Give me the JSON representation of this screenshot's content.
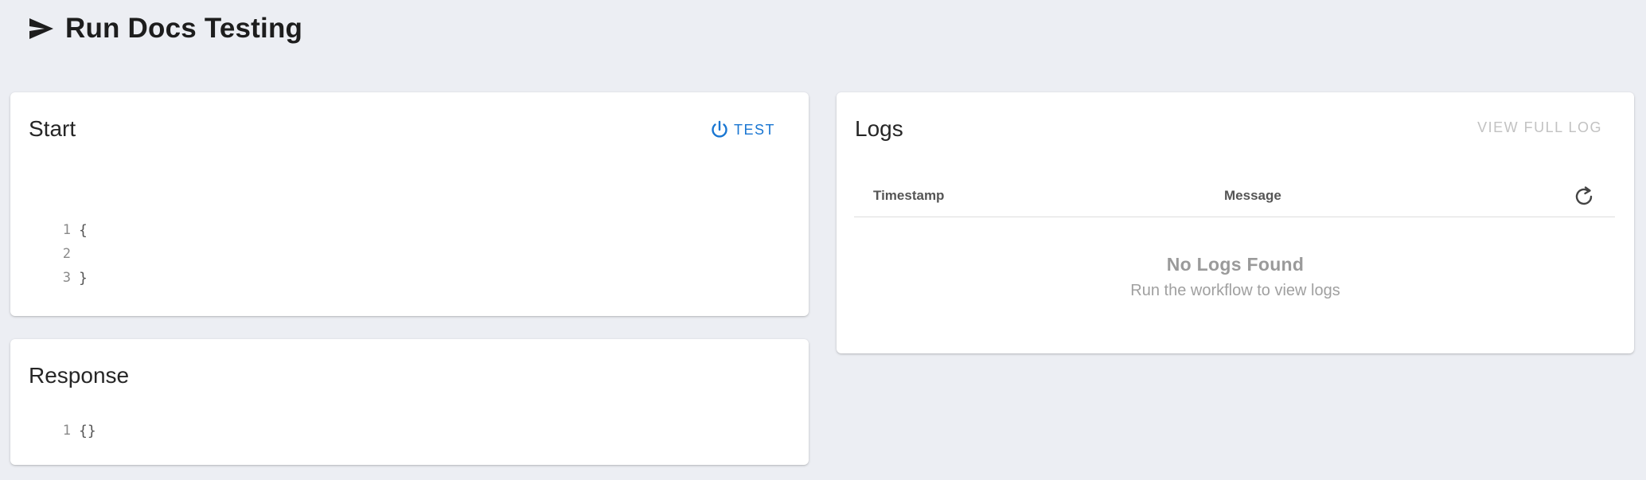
{
  "header": {
    "title": "Run Docs Testing",
    "icon": "send-icon"
  },
  "start": {
    "title": "Start",
    "test_label": "TEST",
    "test_icon": "power-icon",
    "code_lines": [
      {
        "no": "1",
        "text": "{"
      },
      {
        "no": "2",
        "text": ""
      },
      {
        "no": "3",
        "text": "}"
      }
    ]
  },
  "response": {
    "title": "Response",
    "code_lines": [
      {
        "no": "1",
        "text": "{}"
      }
    ]
  },
  "logs": {
    "title": "Logs",
    "view_full_log_label": "VIEW FULL LOG",
    "columns": {
      "timestamp": "Timestamp",
      "message": "Message"
    },
    "refresh_icon": "refresh-icon",
    "empty_title": "No Logs Found",
    "empty_subtitle": "Run the workflow to view logs"
  },
  "colors": {
    "background": "#eceef3",
    "accent": "#1976d2",
    "disabled_text": "#c2c2c2"
  }
}
